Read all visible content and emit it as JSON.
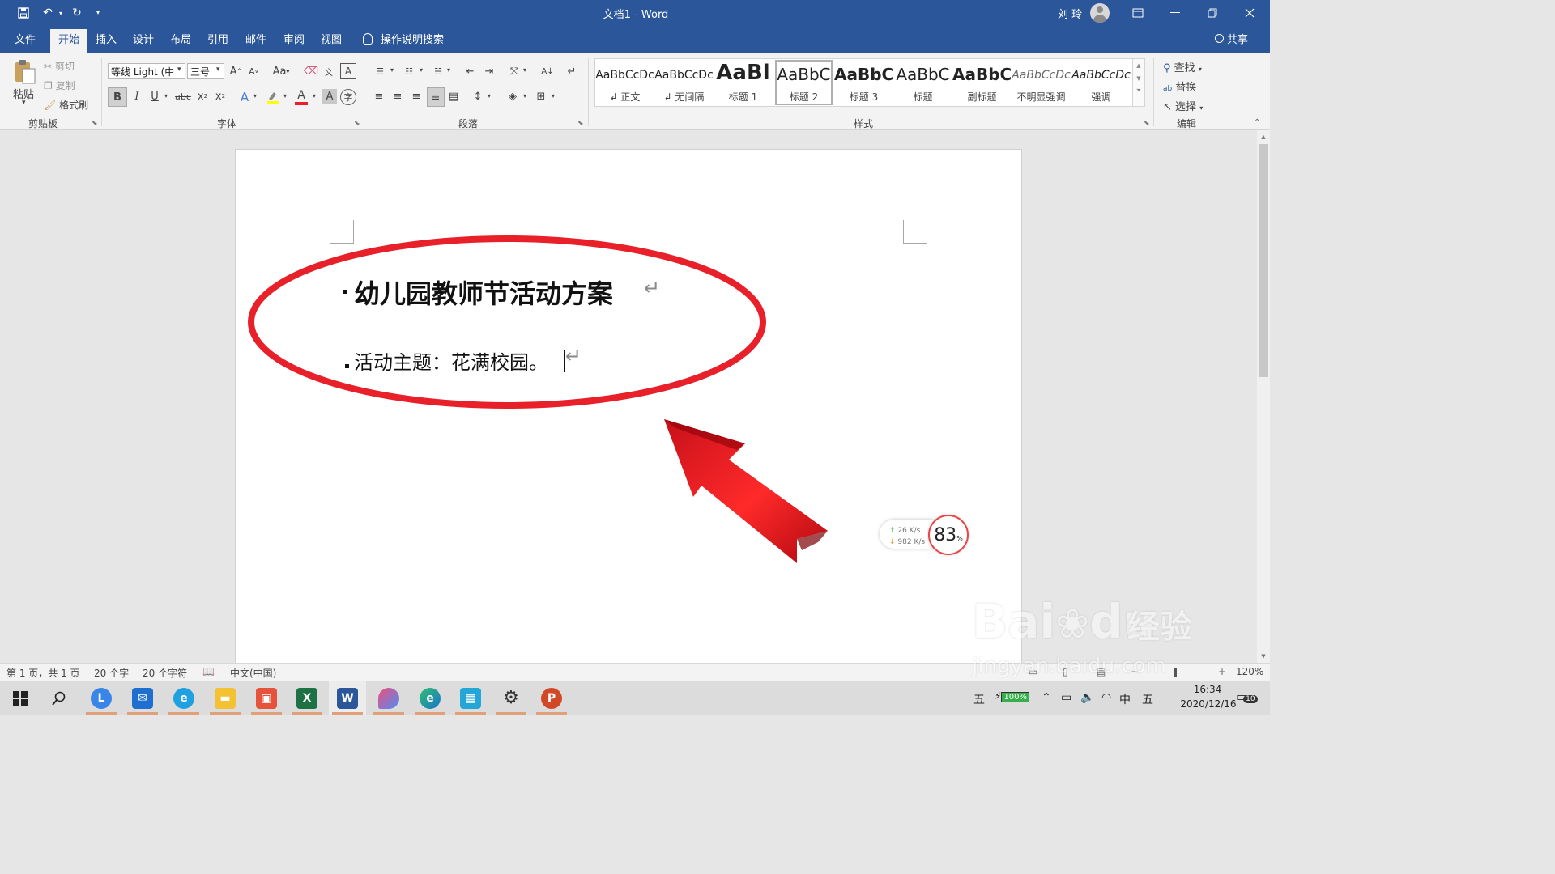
{
  "window": {
    "doc_title": "文档1  -  Word",
    "user_name": "刘 玲"
  },
  "tabs": [
    "文件",
    "开始",
    "插入",
    "设计",
    "布局",
    "引用",
    "邮件",
    "审阅",
    "视图"
  ],
  "active_tab": "开始",
  "tell_me": "操作说明搜索",
  "share": "共享",
  "clipboard": {
    "paste": "粘贴",
    "cut": "剪切",
    "copy": "复制",
    "format_painter": "格式刷",
    "label": "剪贴板"
  },
  "font": {
    "name": "等线 Light (中",
    "size": "三号",
    "label": "字体",
    "change_case": "Aa"
  },
  "paragraph": {
    "label": "段落"
  },
  "styles": {
    "label": "样式",
    "items": [
      {
        "preview": "AaBbCcDc",
        "name": "↲ 正文"
      },
      {
        "preview": "AaBbCcDc",
        "name": "↲ 无间隔"
      },
      {
        "preview": "AaBl",
        "name": "标题 1"
      },
      {
        "preview": "AaBbC",
        "name": "标题 2"
      },
      {
        "preview": "AaBbC",
        "name": "标题 3"
      },
      {
        "preview": "AaBbC",
        "name": "标题"
      },
      {
        "preview": "AaBbC",
        "name": "副标题"
      },
      {
        "preview": "AaBbCcDc",
        "name": "不明显强调"
      },
      {
        "preview": "AaBbCcDc",
        "name": "强调"
      }
    ],
    "selected": "标题 2"
  },
  "editing": {
    "find": "查找",
    "replace": "替换",
    "select": "选择",
    "label": "编辑"
  },
  "document": {
    "heading": "幼儿园教师节活动方案",
    "body": "活动主题：花满校园。"
  },
  "net_widget": {
    "up": "26  K/s",
    "down": "982 K/s",
    "cpu": "83",
    "cpu_unit": "%"
  },
  "status": {
    "page": "第 1 页，共 1 页",
    "words": "20 个字",
    "chars": "20 个字符",
    "language": "中文(中国)",
    "zoom": "120%"
  },
  "taskbar": {
    "battery": "100%",
    "ime": "中",
    "ime2": "五",
    "ime3": "五",
    "time": "16:34",
    "date": "2020/12/16",
    "notifications": "10"
  },
  "watermark": {
    "brand": "Bai",
    "brand2": "du",
    "cn": "经验",
    "url": "jingyan.baidu.com"
  },
  "colors": {
    "word_blue": "#2b579a",
    "annotation_red": "#e8202a",
    "ribbon_bg": "#f3f3f3"
  }
}
